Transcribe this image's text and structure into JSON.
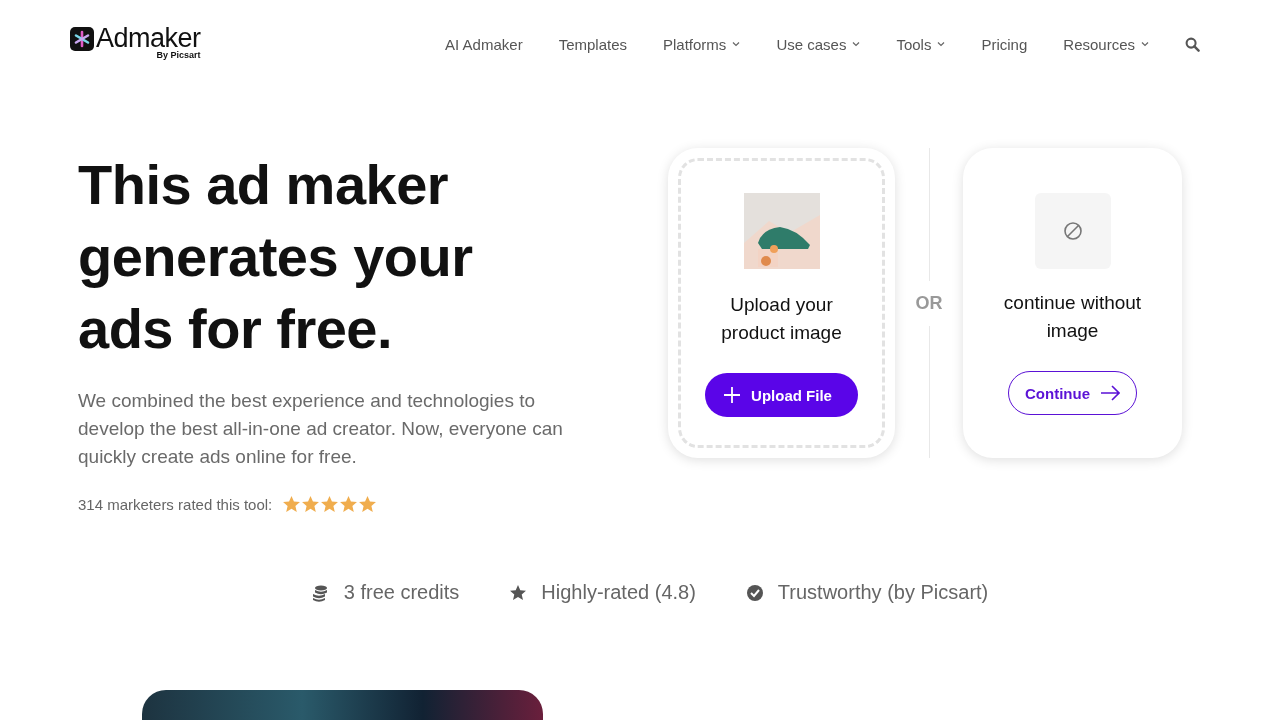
{
  "header": {
    "logo": {
      "wordmark": "Admaker",
      "byline": "By Picsart"
    },
    "nav": [
      {
        "label": "AI Admaker",
        "dropdown": false
      },
      {
        "label": "Templates",
        "dropdown": false
      },
      {
        "label": "Platforms",
        "dropdown": true
      },
      {
        "label": "Use cases",
        "dropdown": true
      },
      {
        "label": "Tools",
        "dropdown": true
      },
      {
        "label": "Pricing",
        "dropdown": false
      },
      {
        "label": "Resources",
        "dropdown": true
      }
    ]
  },
  "hero": {
    "heading": "This ad maker generates your ads for free.",
    "description": "We combined the best experience and technologies to develop the best all-in-one ad creator. Now, everyone can quickly create ads online for free.",
    "rating": {
      "label": "314 marketers rated this tool:",
      "stars": 5
    }
  },
  "cards": [
    {
      "kind": "upload",
      "title": "Upload your product image",
      "button": "Upload File"
    },
    {
      "kind": "skip",
      "title": "continue without image",
      "button": "Continue"
    }
  ],
  "separator": "OR",
  "features": [
    {
      "kind": "coins",
      "label": "3 free credits"
    },
    {
      "kind": "star",
      "label": "Highly-rated (4.8)"
    },
    {
      "kind": "check",
      "label": "Trustworthy (by Picsart)"
    }
  ]
}
